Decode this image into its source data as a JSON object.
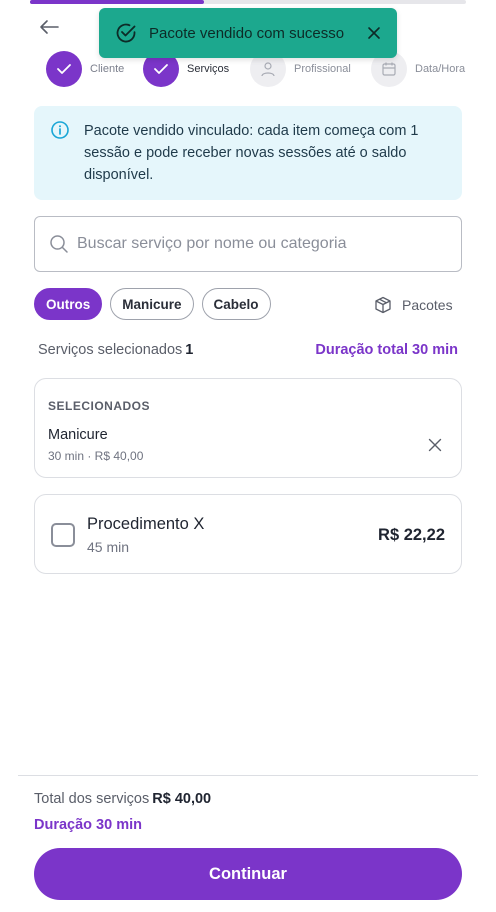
{
  "progress": {
    "fraction": 0.4
  },
  "toast": {
    "message": "Pacote vendido com sucesso",
    "icon": "check-circle-icon",
    "color": "#1ca88e"
  },
  "stepper": {
    "steps": [
      {
        "label": "Cliente",
        "state": "done",
        "icon": "check-icon"
      },
      {
        "label": "Serviços",
        "state": "done-active",
        "icon": "check-icon"
      },
      {
        "label": "Profissional",
        "state": "todo",
        "icon": "user-icon"
      },
      {
        "label": "Data/Hora",
        "state": "todo",
        "icon": "calendar-icon"
      }
    ]
  },
  "info": {
    "text": "Pacote vendido vinculado: cada item começa com 1 sessão e pode receber novas sessões até o saldo disponível.",
    "icon": "info-icon"
  },
  "search": {
    "placeholder": "Buscar serviço por nome ou categoria",
    "value": ""
  },
  "categories": [
    {
      "label": "Outros",
      "selected": true
    },
    {
      "label": "Manicure",
      "selected": false
    },
    {
      "label": "Cabelo",
      "selected": false
    }
  ],
  "packages_button": {
    "label": "Pacotes",
    "icon": "package-icon"
  },
  "summary": {
    "selected_label": "Serviços selecionados",
    "selected_count": "1",
    "duration_text": "Duração total 30 min"
  },
  "selected_section": {
    "title": "SELECIONADOS",
    "items": [
      {
        "name": "Manicure",
        "meta": "30 min · R$ 40,00"
      }
    ]
  },
  "services": [
    {
      "name": "Procedimento X",
      "duration": "45 min",
      "price": "R$ 22,22",
      "checked": false
    }
  ],
  "footer": {
    "total_label": "Total dos serviços",
    "total_value": "R$ 40,00",
    "duration_text": "Duração 30 min",
    "continue_label": "Continuar"
  },
  "colors": {
    "accent": "#7b35c9",
    "toast": "#1ca88e",
    "info_bg": "#e5f6fb"
  }
}
